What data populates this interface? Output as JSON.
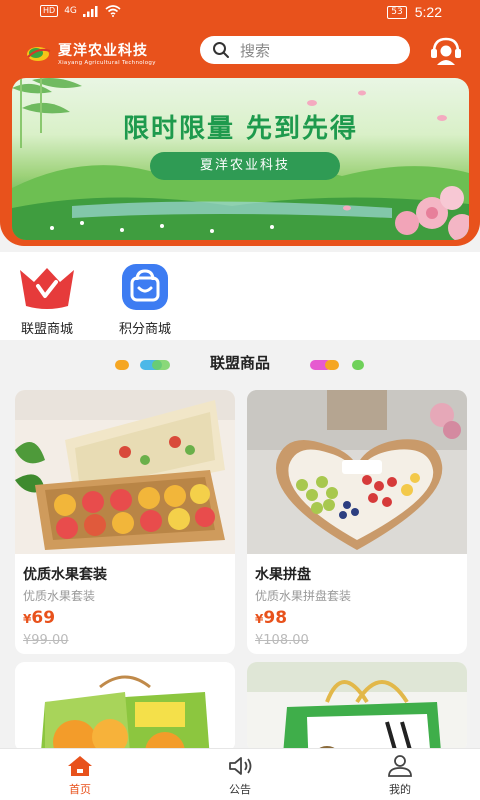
{
  "status_bar": {
    "hd": "HD",
    "network": "4G",
    "battery": "53",
    "time": "5:22"
  },
  "header": {
    "logo_cn": "夏洋农业科技",
    "logo_en": "Xiayang Agricultural Technology",
    "search_placeholder": "搜索",
    "service_icon": "customer-service-icon"
  },
  "banner": {
    "title": "限时限量  先到先得",
    "subtitle": "夏洋农业科技"
  },
  "quick_entries": [
    {
      "label": "联盟商城",
      "icon": "crown-icon",
      "color": "#e63b3b"
    },
    {
      "label": "积分商城",
      "icon": "shopping-bag-icon",
      "color": "#3d7cf2"
    }
  ],
  "section": {
    "title": "联盟商品"
  },
  "products": [
    {
      "name": "优质水果套装",
      "desc": "优质水果套装",
      "currency": "¥",
      "price": "69",
      "original": "¥99.00"
    },
    {
      "name": "水果拼盘",
      "desc": "优质水果拼盘套装",
      "currency": "¥",
      "price": "98",
      "original": "¥108.00"
    },
    {
      "name": "",
      "desc": "",
      "currency": "",
      "price": "",
      "original": ""
    },
    {
      "name": "",
      "desc": "",
      "currency": "",
      "price": "",
      "original": ""
    }
  ],
  "tabs": [
    {
      "label": "首页",
      "icon": "home-icon",
      "active": true
    },
    {
      "label": "公告",
      "icon": "speaker-icon",
      "active": false
    },
    {
      "label": "我的",
      "icon": "user-icon",
      "active": false
    }
  ],
  "colors": {
    "brand": "#e8521c",
    "banner_green": "#1e9a4d"
  }
}
